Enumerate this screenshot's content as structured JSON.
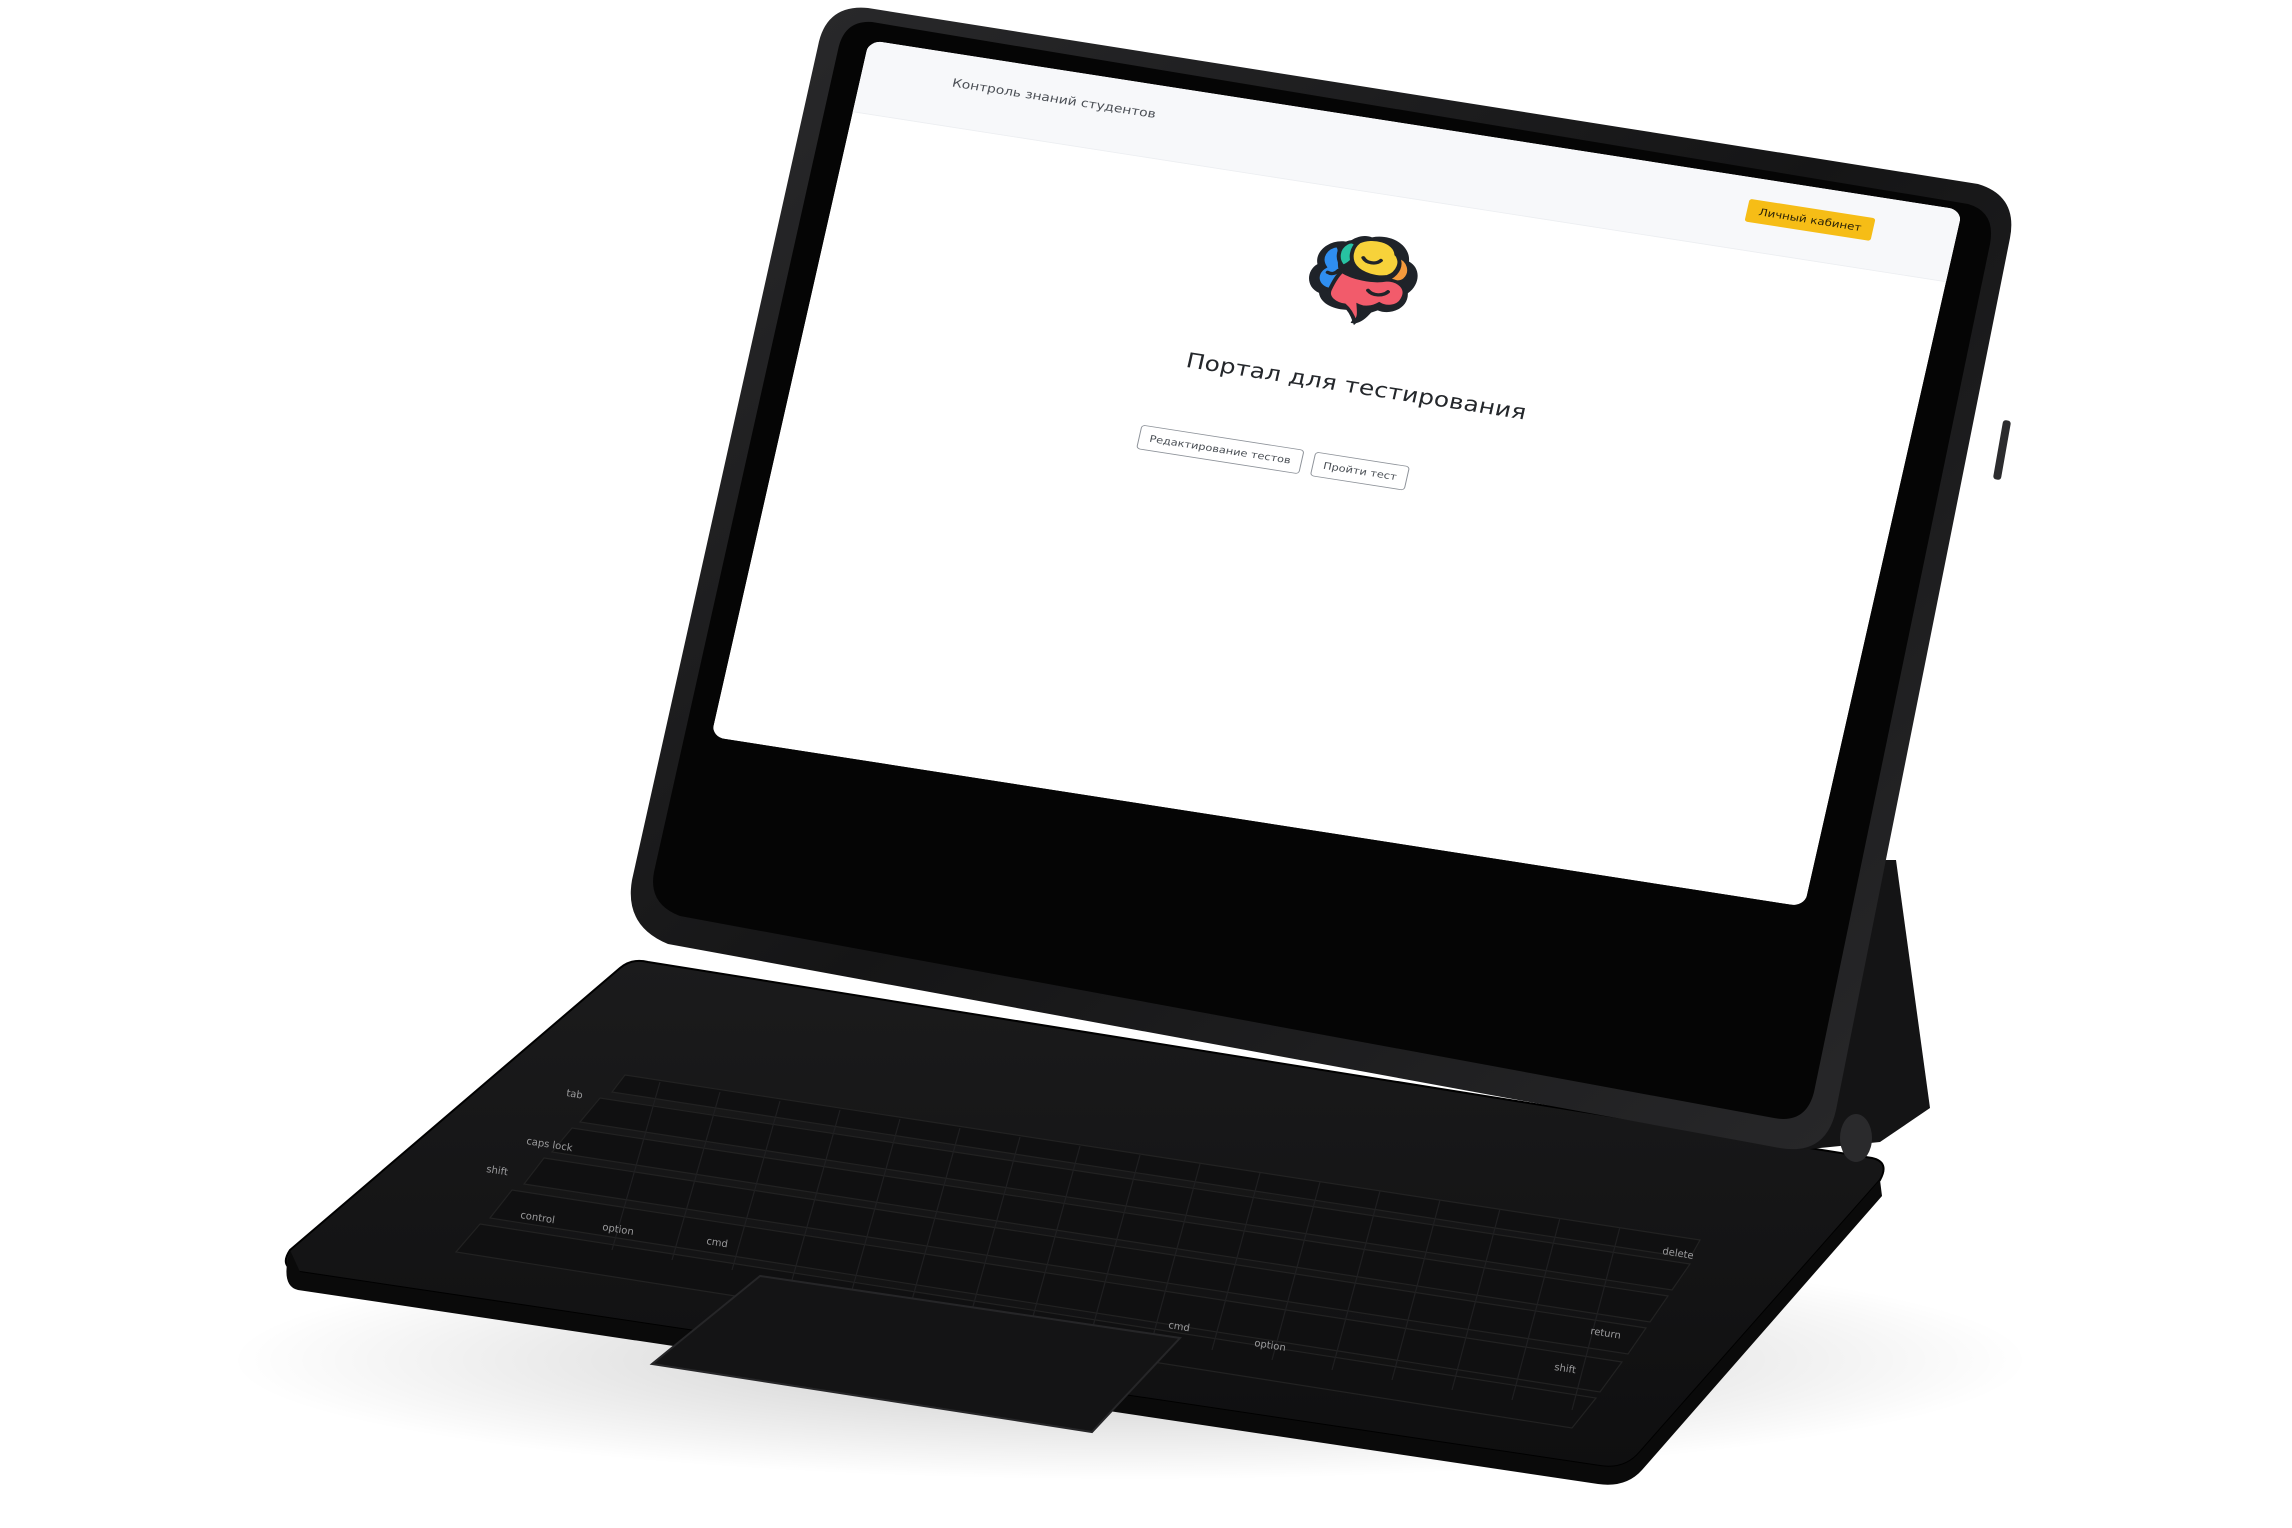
{
  "navbar": {
    "brand": "Контроль знаний студентов",
    "account_button": "Личный кабинет"
  },
  "main": {
    "logo": "colorful-brain-icon",
    "title": "Портал для тестирования",
    "buttons": {
      "edit_tests": "Редактирование тестов",
      "take_test": "Пройти тест"
    }
  },
  "keyboard": {
    "keys": {
      "tab": "tab",
      "caps_lock": "caps lock",
      "shift_left": "shift",
      "control": "control",
      "option_left": "option",
      "cmd_left": "cmd",
      "cmd_right": "cmd",
      "option_right": "option",
      "delete": "delete",
      "return": "return",
      "shift_right": "shift"
    }
  },
  "colors": {
    "accent_yellow": "#f6bd16",
    "device_black": "#111111"
  }
}
